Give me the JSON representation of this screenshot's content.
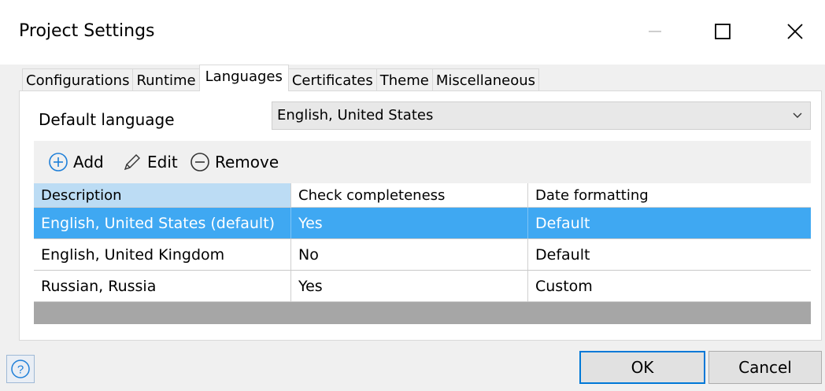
{
  "window": {
    "title": "Project Settings"
  },
  "tabs": [
    {
      "label": "Configurations",
      "active": false
    },
    {
      "label": "Runtime",
      "active": false
    },
    {
      "label": "Languages",
      "active": true
    },
    {
      "label": "Certificates",
      "active": false
    },
    {
      "label": "Theme",
      "active": false
    },
    {
      "label": "Miscellaneous",
      "active": false
    }
  ],
  "default_language": {
    "label": "Default language",
    "value": "English, United States"
  },
  "toolbar": {
    "add_label": "Add",
    "edit_label": "Edit",
    "remove_label": "Remove"
  },
  "table": {
    "columns": [
      "Description",
      "Check completeness",
      "Date formatting"
    ],
    "rows": [
      {
        "description": "English, United States (default)",
        "check": "Yes",
        "date": "Default",
        "selected": true
      },
      {
        "description": "English, United Kingdom",
        "check": "No",
        "date": "Default",
        "selected": false
      },
      {
        "description": "Russian, Russia",
        "check": "Yes",
        "date": "Custom",
        "selected": false
      }
    ]
  },
  "footer": {
    "help_glyph": "?",
    "ok_label": "OK",
    "cancel_label": "Cancel"
  },
  "colors": {
    "selection": "#3fa8f2",
    "header_highlight": "#bcdcf4",
    "accent": "#0078d7",
    "icon_blue": "#1e7fd8"
  },
  "icons": [
    "minimize-icon",
    "maximize-icon",
    "close-icon",
    "chevron-down-icon",
    "add-circle-icon",
    "pencil-icon",
    "remove-circle-icon",
    "help-icon"
  ]
}
